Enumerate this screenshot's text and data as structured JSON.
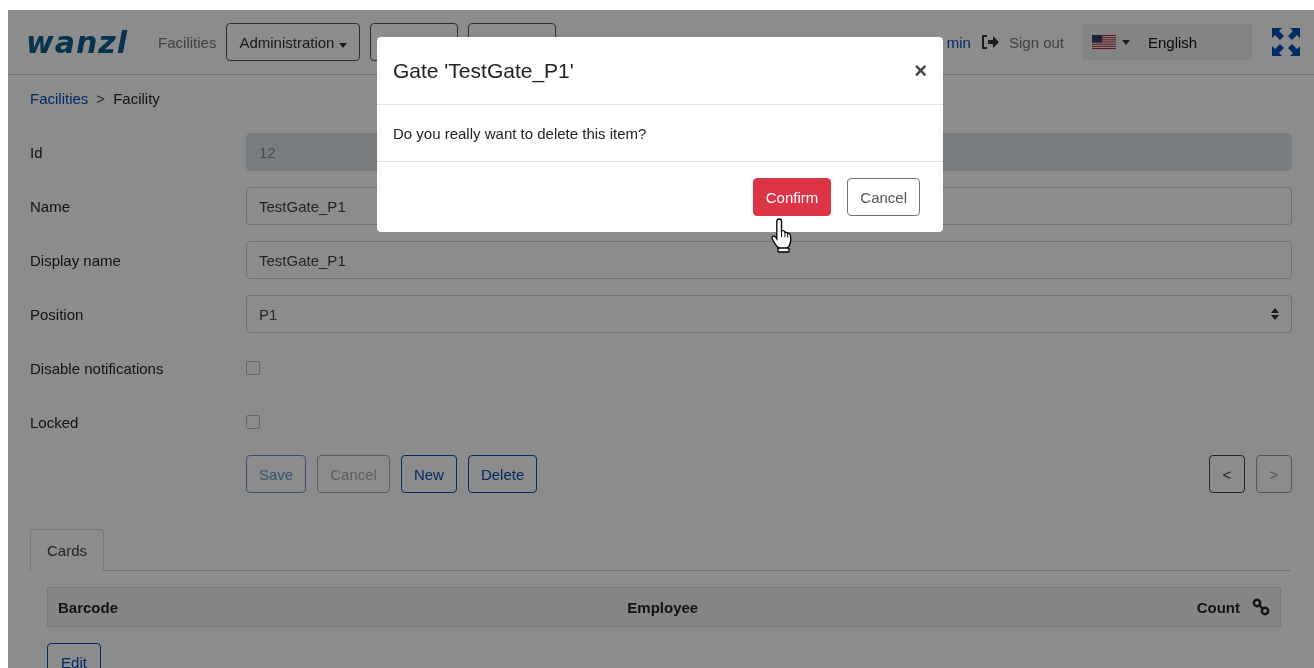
{
  "header": {
    "logo": "wanzl",
    "nav": [
      {
        "kind": "link",
        "label": "Facilities"
      },
      {
        "kind": "dropdown",
        "label": "Administration"
      },
      {
        "kind": "hidden"
      },
      {
        "kind": "hidden"
      }
    ],
    "user_link": "min",
    "sign_out": "Sign out",
    "language": "English"
  },
  "breadcrumb": {
    "parent": "Facilities",
    "separator": ">",
    "current": "Facility"
  },
  "form": [
    {
      "kind": "text",
      "label": "Id",
      "value": "12",
      "disabled": true
    },
    {
      "kind": "text",
      "label": "Name",
      "value": "TestGate_P1",
      "disabled": false
    },
    {
      "kind": "text",
      "label": "Display name",
      "value": "TestGate_P1",
      "disabled": false
    },
    {
      "kind": "select",
      "label": "Position",
      "value": "P1"
    },
    {
      "kind": "checkbox",
      "label": "Disable notifications",
      "checked": false
    },
    {
      "kind": "checkbox",
      "label": "Locked",
      "checked": false
    }
  ],
  "actions": [
    {
      "label": "Save",
      "disabled": true,
      "kind": "primary"
    },
    {
      "label": "Cancel",
      "disabled": true,
      "kind": "secondary"
    },
    {
      "label": "New",
      "disabled": false,
      "kind": "primary"
    },
    {
      "label": "Delete",
      "disabled": false,
      "kind": "primary"
    }
  ],
  "pager": [
    {
      "label": "<",
      "disabled": false
    },
    {
      "label": ">",
      "disabled": true
    }
  ],
  "tabs": [
    {
      "label": "Cards",
      "selected": true
    }
  ],
  "table": {
    "columns": [
      "Barcode",
      "Employee",
      "Count"
    ]
  },
  "edit_button": "Edit",
  "dialog": {
    "title": "Gate 'TestGate_P1'",
    "close": "×",
    "message": "Do you really want to delete this item?",
    "confirm": "Confirm",
    "cancel": "Cancel"
  }
}
